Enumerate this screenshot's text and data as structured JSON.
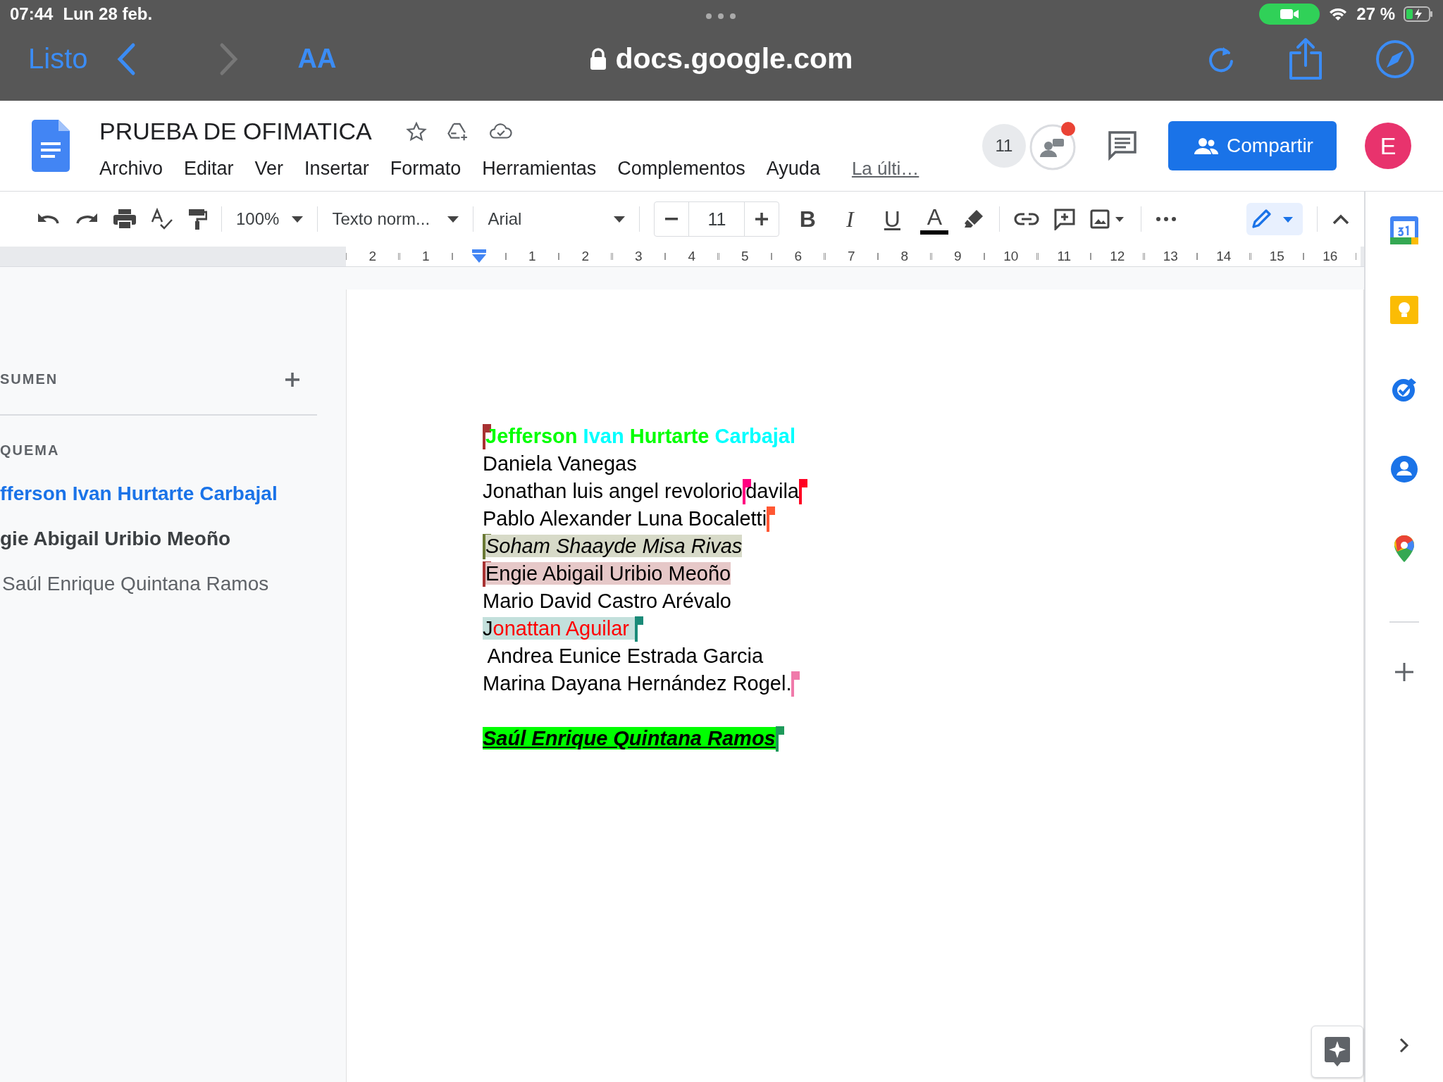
{
  "status_bar": {
    "time": "07:44",
    "date": "Lun 28 feb.",
    "battery": "27 %"
  },
  "browser": {
    "done": "Listo",
    "text_size": "AA",
    "url": "docs.google.com"
  },
  "doc_header": {
    "title": "PRUEBA DE OFIMATICA",
    "menu": [
      "Archivo",
      "Editar",
      "Ver",
      "Insertar",
      "Formato",
      "Herramientas",
      "Complementos",
      "Ayuda"
    ],
    "last_edit": "La últi…",
    "viewer_count": "11",
    "share": "Compartir",
    "avatar": "E"
  },
  "toolbar": {
    "zoom": "100%",
    "style": "Texto norm...",
    "font": "Arial",
    "font_size": "11",
    "format": [
      "B",
      "I",
      "U",
      "A"
    ]
  },
  "ruler": {
    "left_labels": [
      "2",
      "1"
    ],
    "right_labels": [
      "1",
      "2",
      "3",
      "4",
      "5",
      "6",
      "7",
      "8",
      "9",
      "10",
      "11",
      "12",
      "13",
      "14",
      "15",
      "16"
    ]
  },
  "sidebar": {
    "summary": "SUMEN",
    "outline_title": "QUEMA",
    "outline": [
      {
        "text": "fferson Ivan Hurtarte Carbajal",
        "selected": true
      },
      {
        "text": "gie Abigail Uribio Meoño",
        "selected": false,
        "children": [
          {
            "text": "Saúl Enrique Quintana Ramos",
            "selected": false
          }
        ]
      }
    ]
  },
  "document": {
    "lines": [
      {
        "parts": [
          {
            "kind": "cursor",
            "color": "#a83232"
          },
          {
            "kind": "text",
            "runs": [
              {
                "text": "Jefferson ",
                "color": "#00ff00",
                "bold": true
              },
              {
                "text": "Ivan ",
                "color": "#00ffff",
                "bold": true
              },
              {
                "text": "Hurtarte ",
                "color": "#00ff00",
                "bold": true
              },
              {
                "text": "Carbajal",
                "color": "#00ffff",
                "bold": true
              }
            ]
          }
        ]
      },
      {
        "parts": [
          {
            "kind": "text",
            "runs": [
              {
                "text": "Daniela Vanegas"
              }
            ]
          }
        ]
      },
      {
        "parts": [
          {
            "kind": "text",
            "runs": [
              {
                "text": "Jonathan luis angel revolorio"
              }
            ]
          },
          {
            "kind": "cursor",
            "color": "#ff0080"
          },
          {
            "kind": "text",
            "runs": [
              {
                "text": "davila"
              }
            ]
          },
          {
            "kind": "cursor",
            "color": "#ff0022"
          }
        ]
      },
      {
        "parts": [
          {
            "kind": "text",
            "runs": [
              {
                "text": "Pablo Alexander Luna Bocaletti"
              }
            ]
          },
          {
            "kind": "cursor",
            "color": "#ff5733"
          }
        ]
      },
      {
        "parts": [
          {
            "kind": "cursor",
            "color": "#6b7a35"
          },
          {
            "kind": "text",
            "runs": [
              {
                "text": "Soham Shaayde Misa Rivas",
                "italic": true,
                "highlight": {
                  "color": "#d7dac8"
                }
              }
            ]
          }
        ]
      },
      {
        "parts": [
          {
            "kind": "cursor",
            "color": "#a83232"
          },
          {
            "kind": "text",
            "runs": [
              {
                "text": "Engie Abigail Uribio Meoño",
                "highlight": {
                  "color": "#e6c8c8"
                }
              }
            ]
          }
        ]
      },
      {
        "parts": [
          {
            "kind": "text",
            "runs": [
              {
                "text": "Mario David Castro Arévalo"
              }
            ]
          }
        ]
      },
      {
        "parts": [
          {
            "kind": "text",
            "runs": [
              {
                "text": "J",
                "highlight": {
                  "color": "#c3e0dc"
                }
              },
              {
                "text": "onattan Aguilar ",
                "color": "#ff0000",
                "highlight": {
                  "color": "#c3e0dc"
                }
              }
            ]
          },
          {
            "kind": "cursor",
            "color": "#1a8a78"
          }
        ]
      },
      {
        "parts": [
          {
            "kind": "text",
            "runs": [
              {
                "text": " Andrea Eunice Estrada Garcia"
              }
            ]
          }
        ]
      },
      {
        "parts": [
          {
            "kind": "text",
            "runs": [
              {
                "text": "Marina Dayana Hernández Rogel."
              }
            ]
          },
          {
            "kind": "cursor",
            "color": "#f07aaa"
          }
        ]
      },
      {
        "gap_before": true,
        "parts": [
          {
            "kind": "text",
            "runs": [
              {
                "text": "Saúl Enrique Quintana Ramos",
                "bold": true,
                "italic": true,
                "underline": true,
                "highlight": {
                  "color": "#00ff00"
                }
              }
            ]
          },
          {
            "kind": "cursor",
            "color": "#1e9a5a"
          }
        ]
      }
    ]
  }
}
